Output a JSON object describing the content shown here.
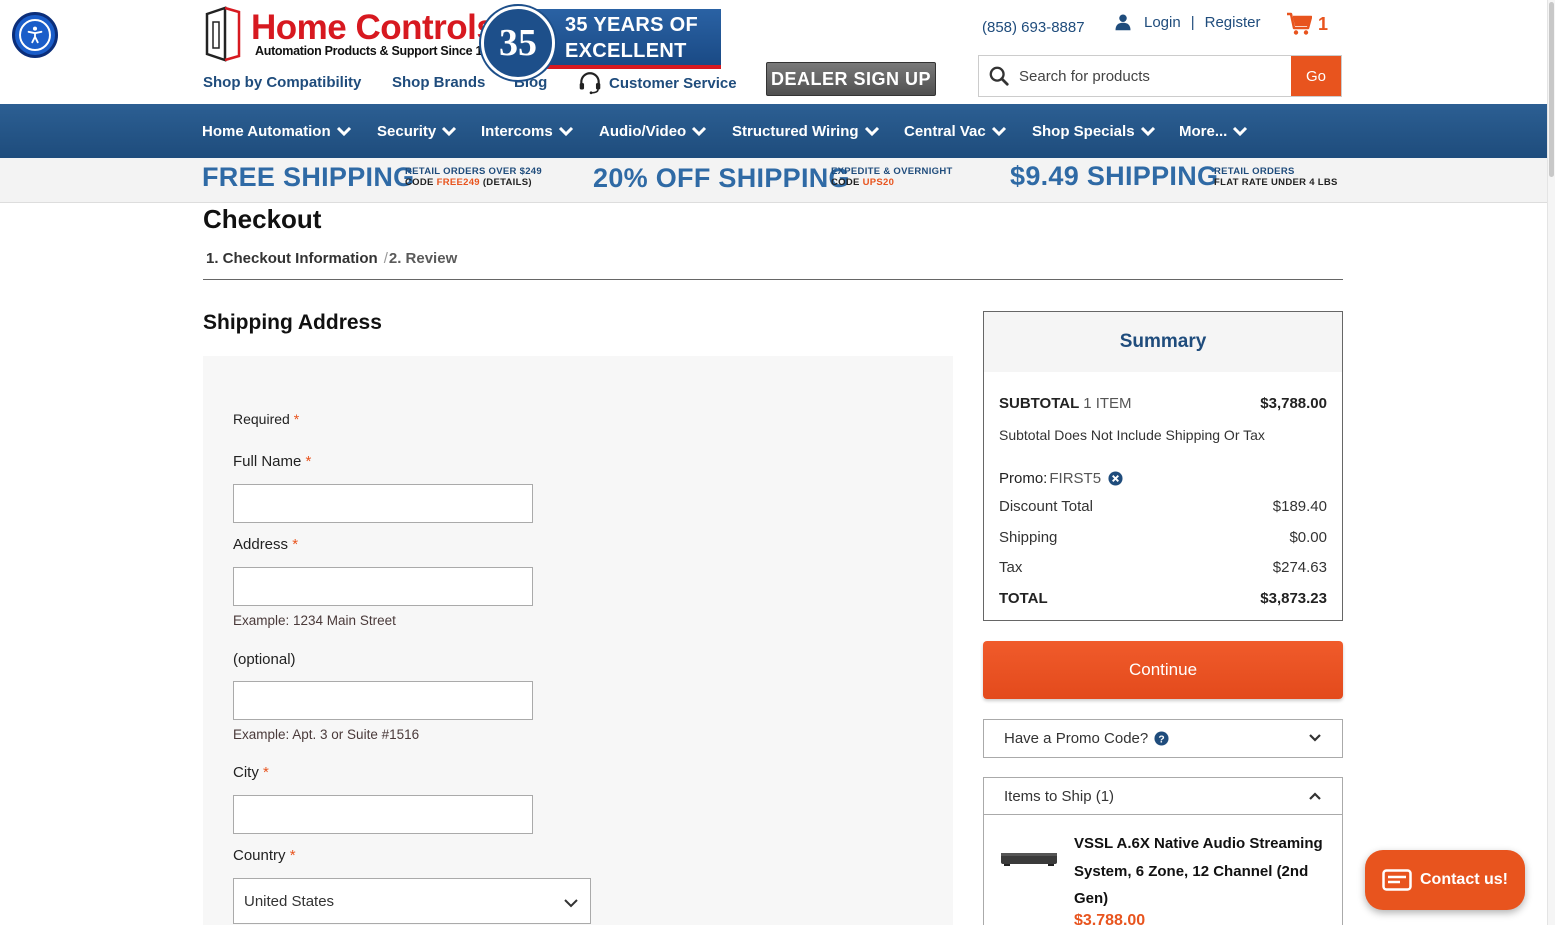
{
  "accessibility": {
    "label": ""
  },
  "logo": {
    "title": "Home Controls",
    "subtitle": "Automation Products & Support Since 1989",
    "badge_number": "35",
    "badge_line1": "35 YEARS OF",
    "badge_line2": "EXCELLENT SERVICE"
  },
  "topnav": {
    "shop_compat": "Shop by Compatibility",
    "shop_brands": "Shop Brands",
    "blog": "Blog",
    "customer_service": "Customer Service",
    "dealer": "DEALER SIGN UP"
  },
  "header": {
    "phone": "(858) 693-8887",
    "login": "Login",
    "sep": "|",
    "register": "Register",
    "cart_count": "1"
  },
  "search": {
    "placeholder": "Search for products",
    "go": "Go"
  },
  "mainnav": [
    {
      "label": "Home Automation"
    },
    {
      "label": "Security"
    },
    {
      "label": "Intercoms"
    },
    {
      "label": "Audio/Video"
    },
    {
      "label": "Structured Wiring"
    },
    {
      "label": "Central Vac"
    },
    {
      "label": "Shop Specials"
    },
    {
      "label": "More..."
    }
  ],
  "promo": {
    "p1_big": "FREE SHIPPING",
    "p1_small1": "RETAIL ORDERS OVER $249",
    "p1_small2_a": "CODE ",
    "p1_small2_code": "FREE249",
    "p1_small2_b": " (DETAILS)",
    "p2_big": "20% OFF SHIPPING",
    "p2_small1": "EXPEDITE & OVERNIGHT",
    "p2_small2_a": "CODE ",
    "p2_small2_code": "UPS20",
    "p3_big": "$9.49 SHIPPING",
    "p3_small1": "RETAIL ORDERS",
    "p3_small2": "FLAT RATE UNDER 4 LBS"
  },
  "checkout": {
    "title": "Checkout",
    "step1": "1. Checkout Information",
    "slash": "/",
    "step2": "2. Review"
  },
  "shipping": {
    "title": "Shipping Address",
    "required": "Required",
    "star": "*",
    "full_name": "Full Name",
    "address": "Address",
    "address_hint": "Example: 1234 Main Street",
    "optional": "(optional)",
    "address2_hint": "Example: Apt. 3 or Suite #1516",
    "city": "City",
    "country": "Country",
    "country_value": "United States"
  },
  "summary": {
    "title": "Summary",
    "subtotal_label": "SUBTOTAL",
    "subtotal_items": "1 ITEM",
    "subtotal_value": "$3,788.00",
    "subtotal_note": "Subtotal Does Not Include Shipping Or Tax",
    "promo_label": "Promo:",
    "promo_code": "FIRST5",
    "discount_label": "Discount Total",
    "discount_value": "$189.40",
    "shipping_label": "Shipping",
    "shipping_value": "$0.00",
    "tax_label": "Tax",
    "tax_value": "$274.63",
    "total_label": "TOTAL",
    "total_value": "$3,873.23"
  },
  "continue": "Continue",
  "promo_code_acc": "Have a Promo Code?",
  "items_acc": "Items to Ship (1)",
  "item": {
    "name": "VSSL A.6X Native Audio Streaming System, 6 Zone, 12 Channel (2nd Gen)",
    "price": "$3,788.00"
  },
  "contact": "Contact us!",
  "colors": {
    "brand_blue": "#1f4c7c",
    "accent_orange": "#e8541e",
    "logo_red": "#d71920"
  }
}
